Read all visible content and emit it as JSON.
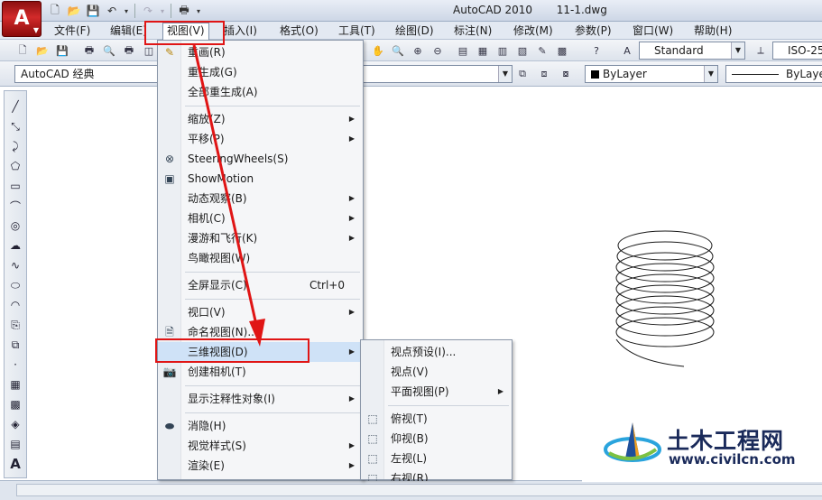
{
  "window": {
    "title": "AutoCAD 2010       11-1.dwg",
    "app_button": "A"
  },
  "quick_access": {
    "icons": [
      "new-icon",
      "open-icon",
      "save-icon",
      "undo-icon",
      "redo-icon",
      "plot-icon"
    ]
  },
  "menubar": {
    "items": [
      "文件(F)",
      "编辑(E)",
      "视图(V)",
      "插入(I)",
      "格式(O)",
      "工具(T)",
      "绘图(D)",
      "标注(N)",
      "修改(M)",
      "参数(P)",
      "窗口(W)",
      "帮助(H)"
    ],
    "active": "视图(V)"
  },
  "toolbar": {
    "text_style": "Standard",
    "dim_style": "ISO-25",
    "workspace": "AutoCAD 经典",
    "layer_color": "ByLayer",
    "linetype": "ByLayer"
  },
  "view_menu": {
    "items": [
      {
        "label": "重画(R)",
        "icon": "pencil-icon"
      },
      {
        "label": "重生成(G)"
      },
      {
        "label": "全部重生成(A)"
      },
      {
        "label": "缩放(Z)",
        "submenu": true
      },
      {
        "label": "平移(P)",
        "submenu": true
      },
      {
        "label": "SteeringWheels(S)",
        "icon": "steering-wheel-icon"
      },
      {
        "label": "ShowMotion",
        "icon": "showmotion-icon"
      },
      {
        "label": "动态观察(B)",
        "submenu": true
      },
      {
        "label": "相机(C)",
        "submenu": true
      },
      {
        "label": "漫游和飞行(K)",
        "submenu": true
      },
      {
        "label": "鸟瞰视图(W)"
      },
      {
        "label": "全屏显示(C)",
        "shortcut": "Ctrl+0"
      },
      {
        "label": "视口(V)",
        "submenu": true
      },
      {
        "label": "命名视图(N)...",
        "icon": "named-view-icon"
      },
      {
        "label": "三维视图(D)",
        "submenu": true
      },
      {
        "label": "创建相机(T)",
        "icon": "camera-icon"
      },
      {
        "label": "显示注释性对象(I)",
        "submenu": true
      },
      {
        "label": "消隐(H)",
        "icon": "hide-icon"
      },
      {
        "label": "视觉样式(S)",
        "submenu": true
      },
      {
        "label": "渲染(E)",
        "submenu": true
      }
    ]
  },
  "view3d_menu": {
    "items": [
      {
        "label": "视点预设(I)..."
      },
      {
        "label": "视点(V)"
      },
      {
        "label": "平面视图(P)",
        "submenu": true
      },
      {
        "label": "俯视(T)",
        "icon": "top-view-icon"
      },
      {
        "label": "仰视(B)",
        "icon": "bottom-view-icon"
      },
      {
        "label": "左视(L)",
        "icon": "left-view-icon"
      },
      {
        "label": "右视(R)",
        "icon": "right-view-icon"
      }
    ]
  },
  "watermark": {
    "name": "土木工程网",
    "url": "www.civilcn.com"
  },
  "colors": {
    "highlight_red": "#e01515",
    "menu_bg": "#f5f6f8",
    "menubar_bg": "#e3e9f2"
  }
}
